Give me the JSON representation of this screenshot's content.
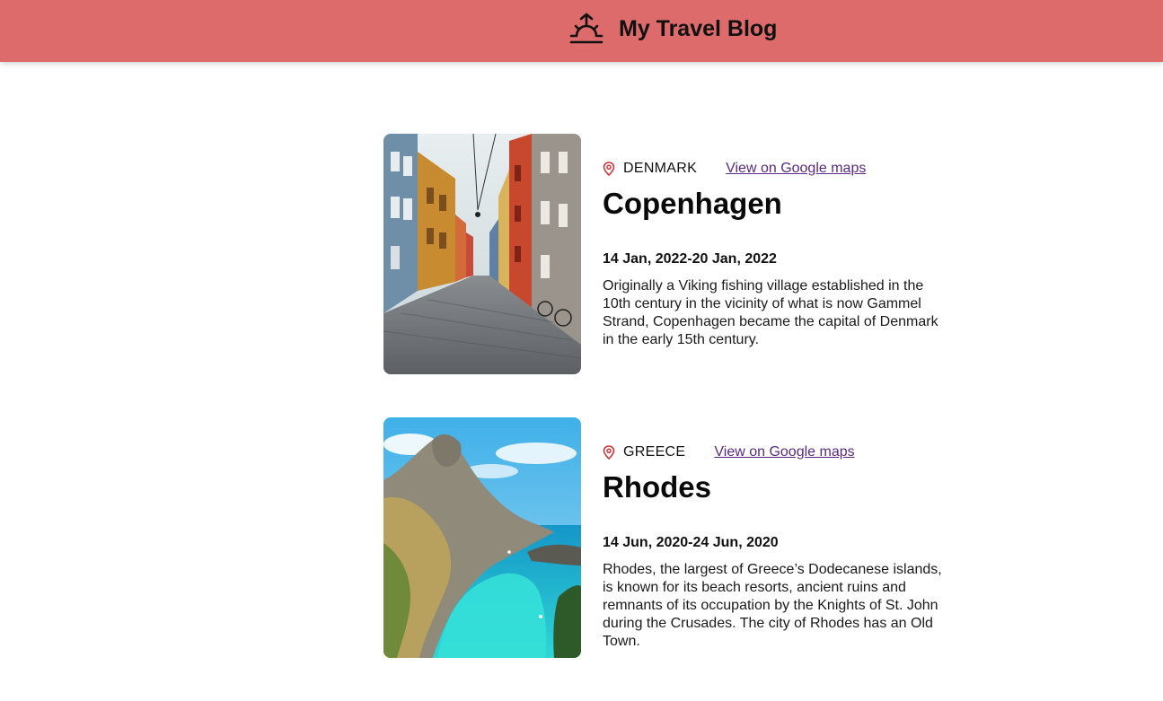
{
  "header": {
    "title": "My Travel Blog",
    "icon": "sunrise-icon",
    "background": "#dd6b6b"
  },
  "entries": [
    {
      "image": "copenhagen-street-photo",
      "country": "DENMARK",
      "map_link": "View on Google maps",
      "place": "Copenhagen",
      "dates": "14 Jan, 2022-20 Jan, 2022",
      "description": "Originally a Viking fishing village established in the 10th century in the vicinity of what is now Gammel Strand, Copenhagen became the capital of Denmark in the early 15th century."
    },
    {
      "image": "rhodes-coast-photo",
      "country": "GREECE",
      "map_link": "View on Google maps",
      "place": "Rhodes",
      "dates": "14 Jun, 2020-24 Jun, 2020",
      "description": "Rhodes, the largest of Greece’s Dodecanese islands, is known for its beach resorts, ancient ruins and remnants of its occupation by the Knights of St. John during the Crusades. The city of Rhodes has an Old Town."
    }
  ],
  "colors": {
    "accent": "#dd6b6b",
    "pin": "#d0343a",
    "link": "#5a2a82"
  }
}
